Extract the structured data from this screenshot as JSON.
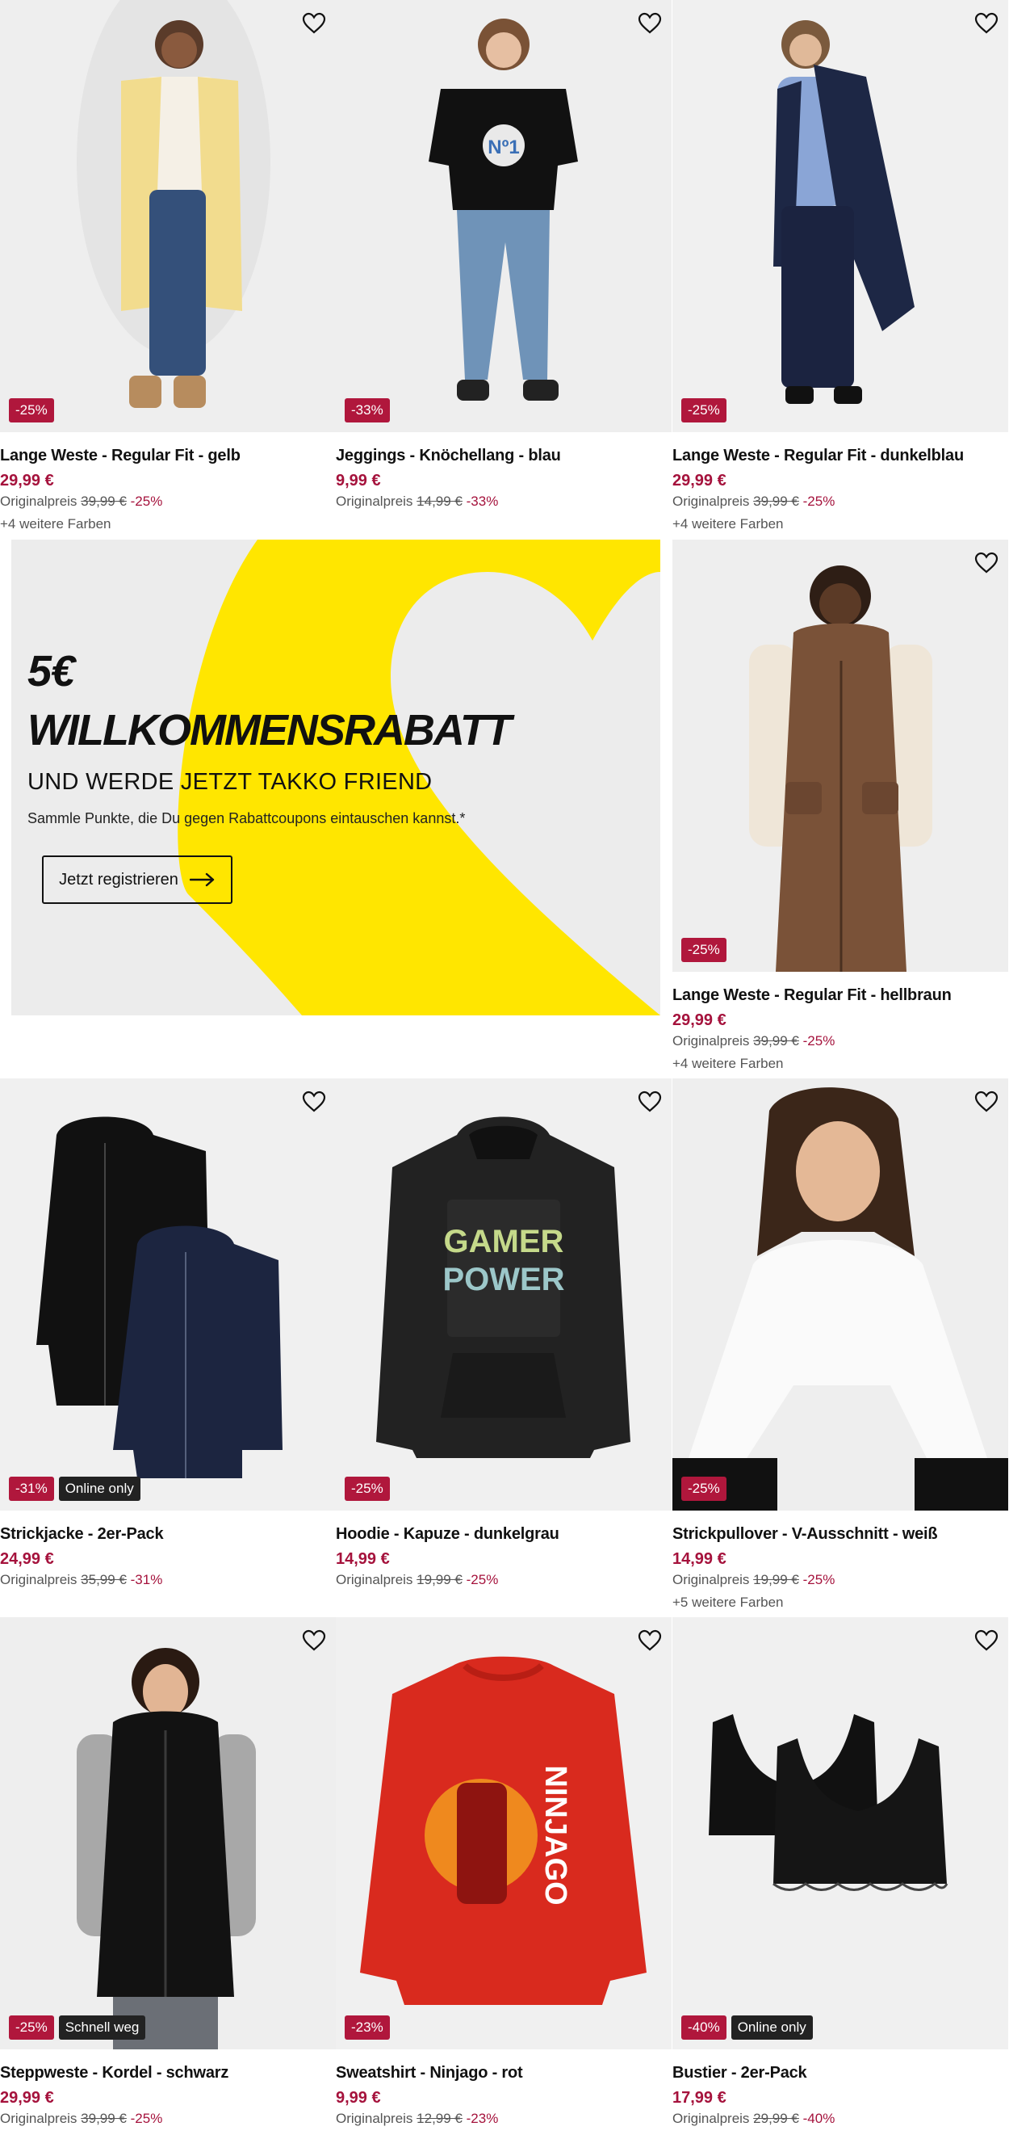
{
  "labels": {
    "original_price": "Originalpreis"
  },
  "products": [
    {
      "id": "p1",
      "title": "Lange Weste - Regular Fit - gelb",
      "price": "29,99 €",
      "old_price": "39,99 €",
      "discount": "-25%",
      "badge_extra": "",
      "more_colors": "+4 weitere Farben"
    },
    {
      "id": "p2",
      "title": "Jeggings - Knöchellang - blau",
      "price": "9,99 €",
      "old_price": "14,99 €",
      "discount": "-33%",
      "badge_extra": "",
      "more_colors": ""
    },
    {
      "id": "p3",
      "title": "Lange Weste - Regular Fit - dunkelblau",
      "price": "29,99 €",
      "old_price": "39,99 €",
      "discount": "-25%",
      "badge_extra": "",
      "more_colors": "+4 weitere Farben"
    },
    {
      "id": "p4",
      "title": "Lange Weste - Regular Fit - hellbraun",
      "price": "29,99 €",
      "old_price": "39,99 €",
      "discount": "-25%",
      "badge_extra": "",
      "more_colors": "+4 weitere Farben"
    },
    {
      "id": "p5",
      "title": "Strickjacke - 2er-Pack",
      "price": "24,99 €",
      "old_price": "35,99 €",
      "discount": "-31%",
      "badge_extra": "Online only",
      "more_colors": ""
    },
    {
      "id": "p6",
      "title": "Hoodie - Kapuze - dunkelgrau",
      "price": "14,99 €",
      "old_price": "19,99 €",
      "discount": "-25%",
      "badge_extra": "",
      "more_colors": ""
    },
    {
      "id": "p7",
      "title": "Strickpullover - V-Ausschnitt - weiß",
      "price": "14,99 €",
      "old_price": "19,99 €",
      "discount": "-25%",
      "badge_extra": "",
      "more_colors": "+5 weitere Farben"
    },
    {
      "id": "p8",
      "title": "Steppweste - Kordel - schwarz",
      "price": "29,99 €",
      "old_price": "39,99 €",
      "discount": "-25%",
      "badge_extra": "Schnell weg",
      "more_colors": ""
    },
    {
      "id": "p9",
      "title": "Sweatshirt - Ninjago - rot",
      "price": "9,99 €",
      "old_price": "12,99 €",
      "discount": "-23%",
      "badge_extra": "",
      "more_colors": ""
    },
    {
      "id": "p10",
      "title": "Bustier - 2er-Pack",
      "price": "17,99 €",
      "old_price": "29,99 €",
      "discount": "-40%",
      "badge_extra": "Online only",
      "more_colors": ""
    }
  ],
  "promo": {
    "amount": "5€",
    "headline": "WILLKOMMENSRABATT",
    "subline": "UND WERDE JETZT TAKKO FRIEND",
    "note": "Sammle Punkte, die Du gegen Rabattcoupons eintauschen kannst.*",
    "cta_label": "Jetzt registrieren"
  },
  "print_texts": {
    "shirt_graphic": "Nº1",
    "hoodie_line1": "GAMER",
    "hoodie_line2": "POWER",
    "sweatshirt_graphic": "NINJAGO"
  },
  "colors": {
    "sale_badge": "#b0173c",
    "price": "#a5123c",
    "promo_yellow": "#ffe600",
    "promo_bg": "#ececec"
  },
  "icons": {
    "wishlist": "heart-outline-icon",
    "cta_arrow": "arrow-right-icon"
  }
}
